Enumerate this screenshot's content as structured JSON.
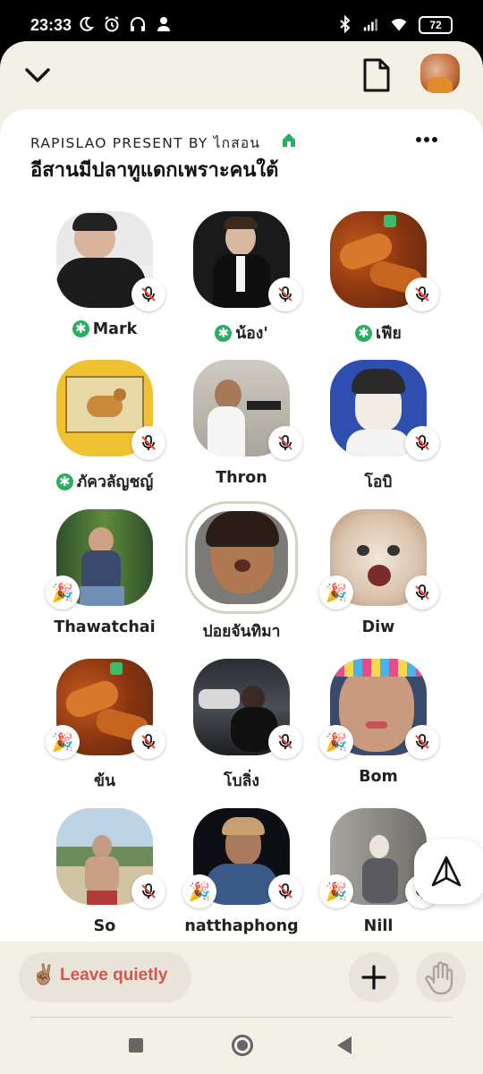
{
  "status_bar": {
    "time": "23:33",
    "battery": "72",
    "icons_left": [
      "moon-icon",
      "alarm-icon",
      "headphones-icon",
      "person-icon"
    ],
    "icons_right": [
      "bluetooth-icon",
      "signal-icon",
      "wifi-icon"
    ]
  },
  "header": {
    "collapse_icon": "chevron-down-icon",
    "document_icon": "document-icon",
    "profile_avatar": "user-avatar"
  },
  "room": {
    "club_line": "RAPISLAO PRESENT BY ไกสอน",
    "club_icon": "house-icon",
    "more_icon": "more-dots-icon",
    "title": "อีสานมีปลาทูแดกเพราะคนใต้",
    "accent_green": "#27ae60"
  },
  "speakers": [
    {
      "name": "Mark",
      "moderator": true,
      "muted": true,
      "new_user": false
    },
    {
      "name": "น้อง'",
      "moderator": true,
      "muted": true,
      "new_user": false
    },
    {
      "name": "เฟีย",
      "moderator": true,
      "muted": true,
      "new_user": false
    },
    {
      "name": "ภัควลัญชญ์",
      "moderator": true,
      "muted": true,
      "new_user": false
    },
    {
      "name": "Thron",
      "moderator": false,
      "muted": true,
      "new_user": false
    },
    {
      "name": "โอบิ",
      "moderator": false,
      "muted": true,
      "new_user": false
    },
    {
      "name": "Thawatchai",
      "moderator": false,
      "muted": false,
      "new_user": true
    },
    {
      "name": "ปอยจันทิมา",
      "moderator": false,
      "muted": false,
      "new_user": false,
      "speaking": true
    },
    {
      "name": "Diw",
      "moderator": false,
      "muted": true,
      "new_user": true
    },
    {
      "name": "ข้น",
      "moderator": false,
      "muted": true,
      "new_user": true
    },
    {
      "name": "โบลิ่ง",
      "moderator": false,
      "muted": true,
      "new_user": false
    },
    {
      "name": "Bom",
      "moderator": false,
      "muted": true,
      "new_user": true
    },
    {
      "name": "So",
      "moderator": false,
      "muted": true,
      "new_user": false
    },
    {
      "name": "natthaphong",
      "moderator": false,
      "muted": true,
      "new_user": true
    },
    {
      "name": "Nill",
      "moderator": false,
      "muted": true,
      "new_user": true
    }
  ],
  "share_icon": "share-send-icon",
  "bottom": {
    "leave_emoji": "✌🏽",
    "leave_label": "Leave quietly",
    "leave_color": "#d4554a",
    "add_icon": "plus-icon",
    "raise_hand_icon": "raise-hand-icon"
  },
  "nav": {
    "recents_icon": "square-icon",
    "home_icon": "circle-icon",
    "back_icon": "triangle-back-icon"
  }
}
